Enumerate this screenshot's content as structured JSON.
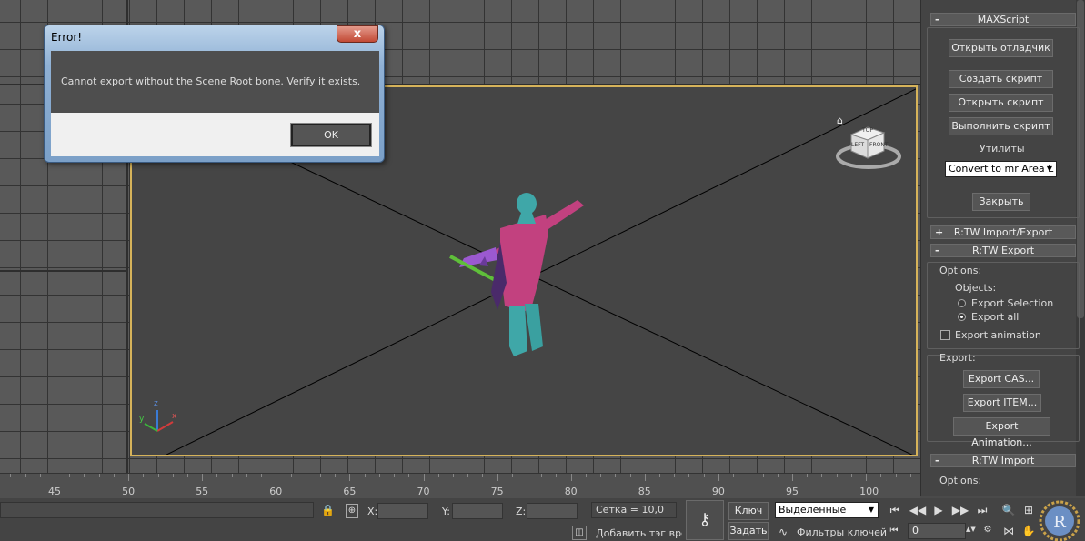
{
  "dialog": {
    "title": "Error!",
    "close": "x",
    "message": "Cannot export without the Scene Root bone. Verify it exists.",
    "ok": "OK"
  },
  "viewcube": {
    "face": "FRONT",
    "top": "TOP",
    "left": "LEFT",
    "home": "⌂"
  },
  "axes": {
    "x": "x",
    "y": "y",
    "z": "z"
  },
  "panel": {
    "maxscript": {
      "header": "MAXScript",
      "sign": "-",
      "open_listener": "Открыть отладчик",
      "new_script": "Создать скрипт",
      "open_script": "Открыть скрипт",
      "run_script": "Выполнить скрипт",
      "utilities": "Утилиты",
      "utility_selected": "Convert to mr Area L",
      "close": "Закрыть"
    },
    "rtw_ie": {
      "header": "R:TW Import/Export",
      "sign": "+"
    },
    "rtw_export": {
      "header": "R:TW Export",
      "sign": "-",
      "options": "Options:",
      "objects": "Objects:",
      "export_selection": "Export Selection",
      "export_all": "Export all",
      "export_animation_chk": "Export animation",
      "export": "Export:",
      "export_cas": "Export CAS...",
      "export_item": "Export ITEM...",
      "export_anim": "Export Animation..."
    },
    "rtw_import": {
      "header": "R:TW Import",
      "sign": "-",
      "options": "Options:"
    }
  },
  "ruler": {
    "labels": [
      "45",
      "50",
      "55",
      "60",
      "65",
      "70",
      "75",
      "80",
      "85",
      "90",
      "95",
      "100"
    ]
  },
  "status": {
    "x_label": "X:",
    "y_label": "Y:",
    "z_label": "Z:",
    "grid": "Сетка = 10,0",
    "add_time_tag": "Добавить тэг врем",
    "key": "Ключ",
    "set": "Задать",
    "selection_mode": "Выделенные",
    "key_filters": "Фильтры ключей",
    "frame": "0"
  }
}
